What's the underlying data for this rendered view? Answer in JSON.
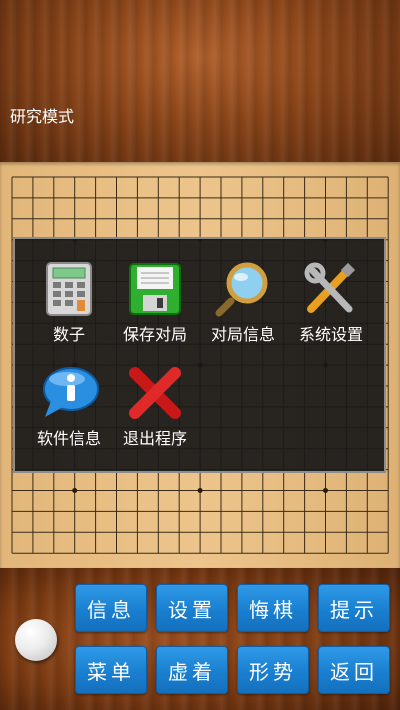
{
  "header": {
    "mode_title": "研究模式"
  },
  "menu": {
    "items": [
      {
        "label": "数子",
        "icon": "calculator-icon"
      },
      {
        "label": "保存对局",
        "icon": "floppy-disk-icon"
      },
      {
        "label": "对局信息",
        "icon": "magnifier-icon"
      },
      {
        "label": "系统设置",
        "icon": "tools-icon"
      },
      {
        "label": "软件信息",
        "icon": "info-bubble-icon"
      },
      {
        "label": "退出程序",
        "icon": "red-x-icon"
      }
    ]
  },
  "toolbar": {
    "row1": [
      "信息",
      "设置",
      "悔棋",
      "提示"
    ],
    "row2": [
      "菜单",
      "虚着",
      "形势",
      "返回"
    ]
  },
  "current_stone": "white"
}
